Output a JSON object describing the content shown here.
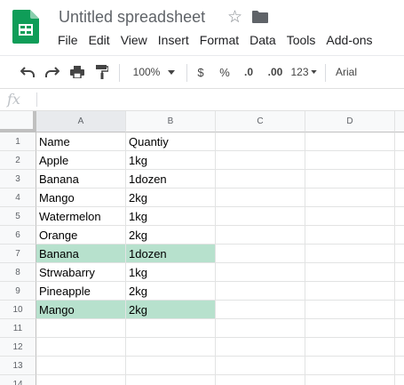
{
  "app": {
    "title": "Untitled spreadsheet",
    "logo_icon": "google-sheets-icon",
    "star_icon": "star-outline-icon",
    "folder_icon": "folder-icon",
    "brand_color": "#0f9d58"
  },
  "menu": [
    "File",
    "Edit",
    "View",
    "Insert",
    "Format",
    "Data",
    "Tools",
    "Add-ons"
  ],
  "toolbar": {
    "zoom": "100%",
    "currency": "$",
    "percent": "%",
    "decrease_decimal": ".0",
    "increase_decimal": ".00",
    "more_formats": "123",
    "font": "Arial",
    "icons": [
      "undo-icon",
      "redo-icon",
      "print-icon",
      "paint-format-icon",
      "chevron-down-icon"
    ]
  },
  "formula_bar": {
    "fx_label": "fx",
    "value": ""
  },
  "sheet": {
    "columns": [
      "A",
      "B",
      "C",
      "D"
    ],
    "rows": [
      {
        "num": "1",
        "a": "Name",
        "b": "Quantiy",
        "highlight": false
      },
      {
        "num": "2",
        "a": "Apple",
        "b": "1kg",
        "highlight": false
      },
      {
        "num": "3",
        "a": "Banana",
        "b": "1dozen",
        "highlight": false
      },
      {
        "num": "4",
        "a": "Mango",
        "b": "2kg",
        "highlight": false
      },
      {
        "num": "5",
        "a": "Watermelon",
        "b": "1kg",
        "highlight": false
      },
      {
        "num": "6",
        "a": "Orange",
        "b": "2kg",
        "highlight": false
      },
      {
        "num": "7",
        "a": "Banana",
        "b": "1dozen",
        "highlight": true
      },
      {
        "num": "8",
        "a": "Strwabarry",
        "b": "1kg",
        "highlight": false
      },
      {
        "num": "9",
        "a": "Pineapple",
        "b": "2kg",
        "highlight": false
      },
      {
        "num": "10",
        "a": "Mango",
        "b": "2kg",
        "highlight": true
      },
      {
        "num": "11",
        "a": "",
        "b": "",
        "highlight": false
      },
      {
        "num": "12",
        "a": "",
        "b": "",
        "highlight": false
      },
      {
        "num": "13",
        "a": "",
        "b": "",
        "highlight": false
      },
      {
        "num": "14",
        "a": "",
        "b": "",
        "highlight": false
      }
    ],
    "highlight_color": "#b7e1cd"
  }
}
